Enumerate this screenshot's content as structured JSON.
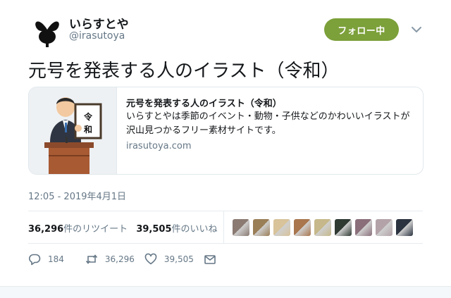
{
  "user": {
    "display_name": "いらすとや",
    "handle": "@irasutoya",
    "avatar_icon": "irasutoya-rabbit-logo-icon"
  },
  "follow_button": {
    "label": "フォロー中",
    "color": "#7ca03a"
  },
  "menu": {
    "icon": "chevron-down-icon"
  },
  "tweet": {
    "text": "元号を発表する人のイラスト（令和）"
  },
  "card": {
    "title": "元号を発表する人のイラスト（令和）",
    "description": "いらすとやは季節のイベント・動物・子供などのかわいいイラストが沢山見つかるフリー素材サイトです。",
    "domain": "irasutoya.com",
    "image_sign_text": "令和"
  },
  "timestamp": "12:05 - 2019年4月1日",
  "stats": {
    "retweets_count": "36,296",
    "retweets_label": "件のリツイート",
    "likes_count": "39,505",
    "likes_label": "件のいいね"
  },
  "liker_colors": [
    "#8a7a72",
    "#9a7e56",
    "#d8c39a",
    "#a9764e",
    "#c6b88a",
    "#2f3a33",
    "#8a6f7a",
    "#b3a3a8",
    "#2b3340"
  ],
  "actions": {
    "reply": {
      "icon": "reply-icon",
      "count": "184"
    },
    "retweet": {
      "icon": "retweet-icon",
      "count": "36,296"
    },
    "like": {
      "icon": "heart-icon",
      "count": "39,505"
    },
    "dm": {
      "icon": "envelope-icon"
    }
  }
}
